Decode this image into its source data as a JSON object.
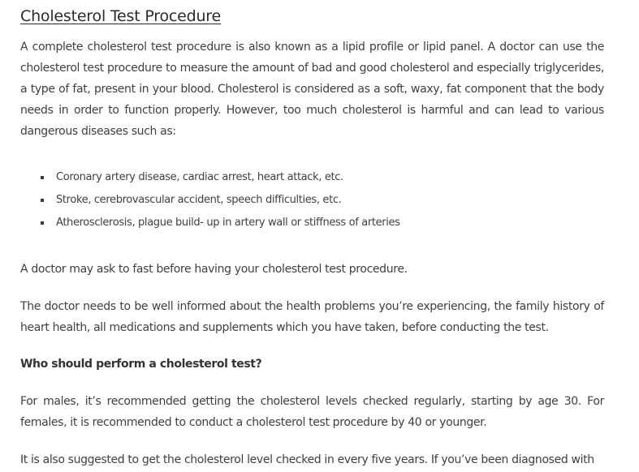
{
  "article": {
    "title": "Cholesterol Test Procedure",
    "intro": "A complete cholesterol test procedure is also known as a lipid profile or lipid panel. A doctor can use the cholesterol test procedure to measure the amount of bad and good cholesterol and especially triglycerides, a type of fat, present in your blood. Cholesterol is considered as a soft, waxy, fat component that the body needs in order to function properly. However, too much cholesterol is harmful and can lead to various dangerous diseases such as:",
    "diseases": [
      "Coronary artery disease, cardiac arrest, heart attack, etc.",
      "Stroke, cerebrovascular accident, speech difficulties, etc.",
      "Atherosclerosis, plague build- up in artery wall or stiffness of arteries"
    ],
    "fasting_note": "A doctor may ask to fast before having your cholesterol test procedure.",
    "doctor_info": "The doctor needs to be well informed about the health problems you’re experiencing, the family history of heart health, all medications and supplements which you have taken, before conducting the test.",
    "subheading": "Who should perform a cholesterol test?",
    "recommendation": "For males, it’s recommended getting the cholesterol levels checked regularly, starting by age 30. For females, it is recommended to conduct a cholesterol test procedure by 40 or younger.",
    "five_years": "It is also suggested to get the cholesterol level checked in every five years. If you’ve been diagnosed with"
  }
}
